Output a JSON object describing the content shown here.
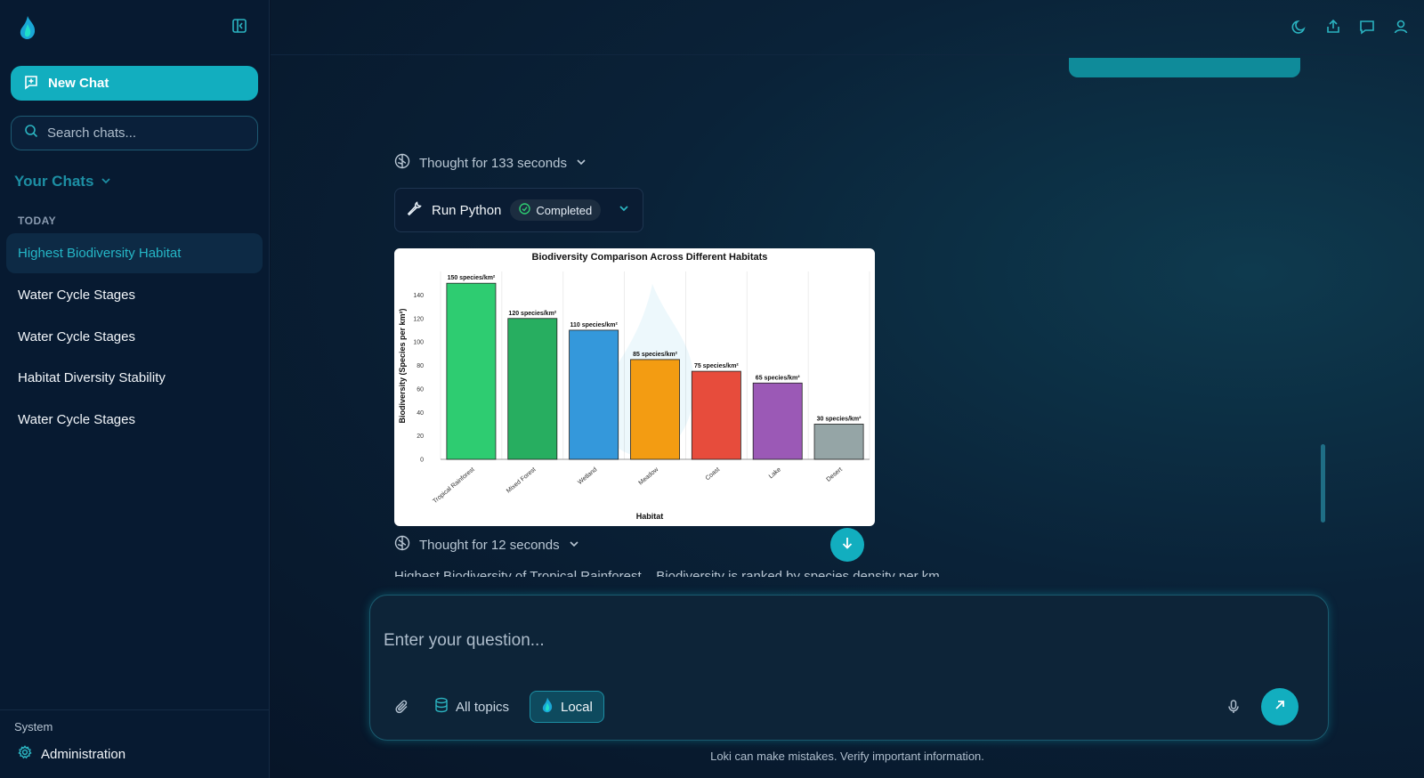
{
  "sidebar": {
    "new_chat_label": "New Chat",
    "search_placeholder": "Search chats...",
    "your_chats_label": "Your Chats",
    "today_label": "TODAY",
    "chats": [
      {
        "label": "Highest Biodiversity Habitat",
        "active": true
      },
      {
        "label": "Water Cycle Stages",
        "active": false
      },
      {
        "label": "Water Cycle Stages",
        "active": false
      },
      {
        "label": "Habitat Diversity Stability",
        "active": false
      },
      {
        "label": "Water Cycle Stages",
        "active": false
      }
    ],
    "system_label": "System",
    "admin_label": "Administration"
  },
  "topbar": {
    "icons": [
      "moon-icon",
      "share-icon",
      "chat-bubble-icon",
      "user-icon"
    ]
  },
  "conversation": {
    "thought_1": "Thought for 133 seconds",
    "tool_name": "Run Python",
    "tool_status": "Completed",
    "thought_2": "Thought for 12 seconds",
    "truncated_text": "Highest Biodiversity of Tropical Rainforest... Biodiversity is ranked by species density per km..."
  },
  "composer": {
    "placeholder": "Enter your question...",
    "topics_label": "All topics",
    "model_label": "Local"
  },
  "footer_note": "Loki can make mistakes. Verify important information.",
  "colors": {
    "accent": "#12aebf",
    "active_chat_text": "#25b6c6"
  },
  "chart_data": {
    "type": "bar",
    "title": "Biodiversity Comparison Across Different Habitats",
    "xlabel": "Habitat",
    "ylabel": "Biodiversity (Species per km²)",
    "ylim": [
      0,
      160
    ],
    "yticks": [
      0,
      20,
      40,
      60,
      80,
      100,
      120,
      140
    ],
    "categories": [
      "Tropical Rainforest",
      "Mixed Forest",
      "Wetland",
      "Meadow",
      "Coast",
      "Lake",
      "Desert"
    ],
    "values": [
      150,
      120,
      110,
      85,
      75,
      65,
      30
    ],
    "data_labels": [
      "150 species/km²",
      "120 species/km²",
      "110 species/km²",
      "85 species/km²",
      "75 species/km²",
      "65 species/km²",
      "30 species/km²"
    ],
    "colors": [
      "#2ecc71",
      "#27ae60",
      "#3498db",
      "#f39c12",
      "#e74c3c",
      "#9b59b6",
      "#95a5a6"
    ],
    "grid": "vertical"
  }
}
